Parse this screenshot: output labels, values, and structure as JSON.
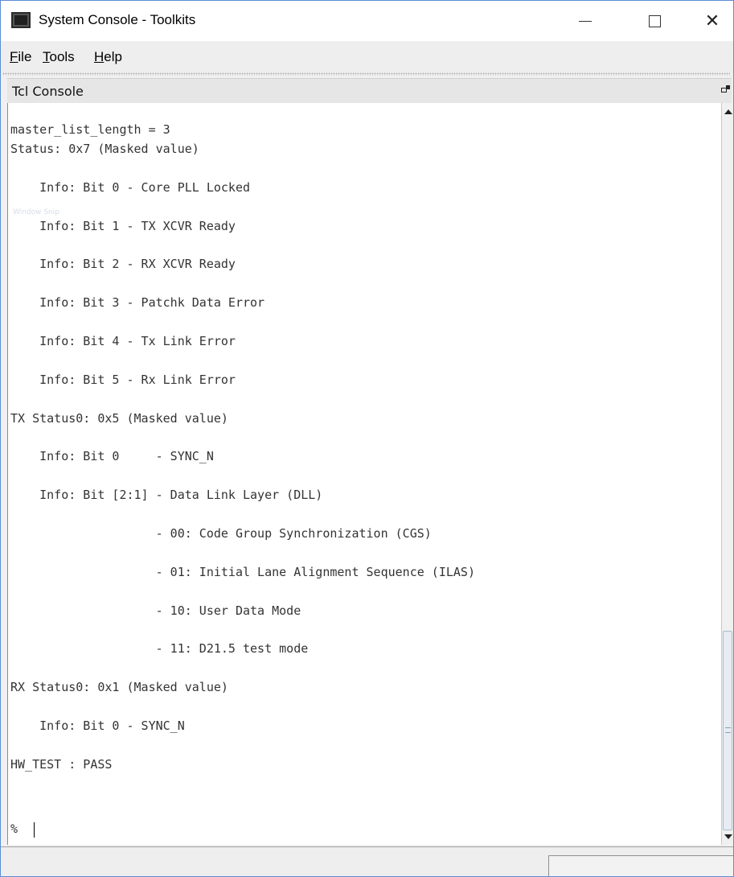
{
  "window": {
    "title": "System Console - Toolkits",
    "close_glyph": "✕"
  },
  "menu": {
    "file_mnemonic": "F",
    "file_rest": "ile",
    "tools_mnemonic": "T",
    "tools_rest": "ools",
    "help_mnemonic": "H",
    "help_rest": "elp"
  },
  "panel": {
    "title": "Tcl Console"
  },
  "console": {
    "output": "master_list_length = 3\nStatus: 0x7 (Masked value)\n\n    Info: Bit 0 - Core PLL Locked\n\n    Info: Bit 1 - TX XCVR Ready\n\n    Info: Bit 2 - RX XCVR Ready\n\n    Info: Bit 3 - Patchk Data Error\n\n    Info: Bit 4 - Tx Link Error\n\n    Info: Bit 5 - Rx Link Error\n\nTX Status0: 0x5 (Masked value)\n\n    Info: Bit 0     - SYNC_N\n\n    Info: Bit [2:1] - Data Link Layer (DLL)\n\n                    - 00: Code Group Synchronization (CGS)\n\n                    - 01: Initial Lane Alignment Sequence (ILAS)\n\n                    - 10: User Data Mode\n\n                    - 11: D21.5 test mode\n\nRX Status0: 0x1 (Masked value)\n\n    Info: Bit 0 - SYNC_N\n\nHW_TEST : PASS",
    "prompt": "%",
    "overlay_text": "Window Snip"
  },
  "icons": {
    "app": "console-window-icon",
    "minimize": "minimize-icon",
    "maximize": "maximize-icon",
    "close": "close-icon",
    "float": "undock-icon",
    "scroll_up": "arrow-up-icon",
    "scroll_down": "arrow-down-icon"
  },
  "colors": {
    "title_border": "#5b8dd6",
    "console_bg": "#ffffff",
    "console_text": "#333333",
    "chrome_bg": "#eeeeee",
    "scroll_thumb": "#e7ecf2"
  }
}
